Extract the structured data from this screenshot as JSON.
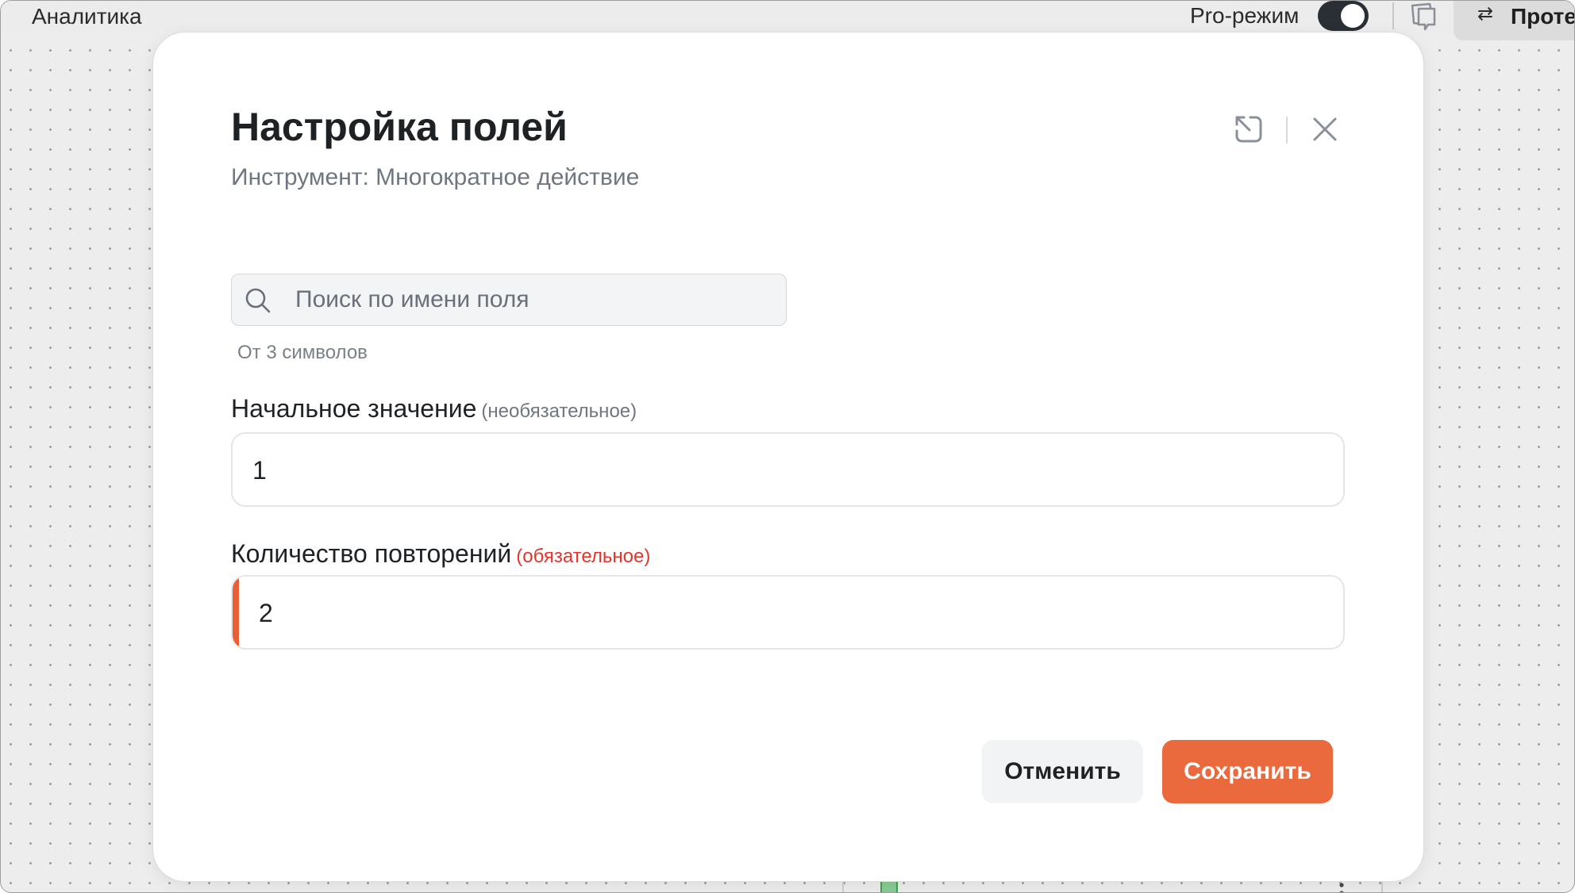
{
  "app": {
    "title": "Аналитика",
    "pro_mode_label": "Pro-режим",
    "pro_mode_enabled": true,
    "test_button_label": "Протестировать"
  },
  "icons": {
    "expand": "expand-icon",
    "close": "close-icon",
    "search": "search-icon",
    "chat": "chat-icon",
    "swap": "swap-arrows-icon"
  },
  "modal": {
    "title": "Настройка полей",
    "subtitle": "Инструмент: Многократное действие",
    "search": {
      "placeholder": "Поиск по имени поля",
      "value": "",
      "hint": "От 3 символов"
    },
    "fields": [
      {
        "label": "Начальное значение",
        "tag": "(необязательное)",
        "value": "1",
        "required": false
      },
      {
        "label": "Количество повторений",
        "tag": "(обязательное)",
        "value": "2",
        "required": true
      }
    ],
    "cancel_label": "Отменить",
    "save_label": "Сохранить"
  },
  "colors": {
    "accent": "#ea6a3e",
    "required_tag": "#e5342c",
    "title_text": "#1e2225"
  }
}
